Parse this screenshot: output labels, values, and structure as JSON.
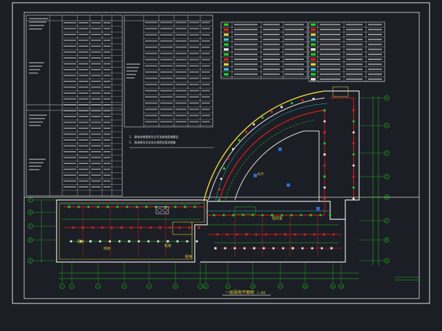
{
  "drawing": {
    "title_text": "一层弱电平面图",
    "scale_text": "1:100",
    "grid_bottom": [
      "1",
      "2",
      "3",
      "4",
      "5",
      "6",
      "7",
      "8",
      "9",
      "10",
      "11",
      "12",
      "13",
      "14"
    ],
    "grid_left": [
      "E",
      "D",
      "C",
      "B",
      "A"
    ],
    "grid_right": [
      "H",
      "G",
      "F",
      "E",
      "D",
      "C",
      "B",
      "A"
    ],
    "colors": {
      "background": "#1b1e24",
      "border": "#e6e6e6",
      "green": "#22cc22",
      "red": "#e02020",
      "yellow": "#e6d23a",
      "cyan": "#39c6d8",
      "blue": "#2f6ad8"
    }
  },
  "notes": {
    "line1": "1. 弱电系统管线均沿吊顶或地面暗敷设",
    "line2": "2. 具体做法详见设计说明及相关图集"
  },
  "room_labels": [
    "厨房",
    "库房",
    "机房",
    "配电",
    "监控室",
    "大厅"
  ]
}
